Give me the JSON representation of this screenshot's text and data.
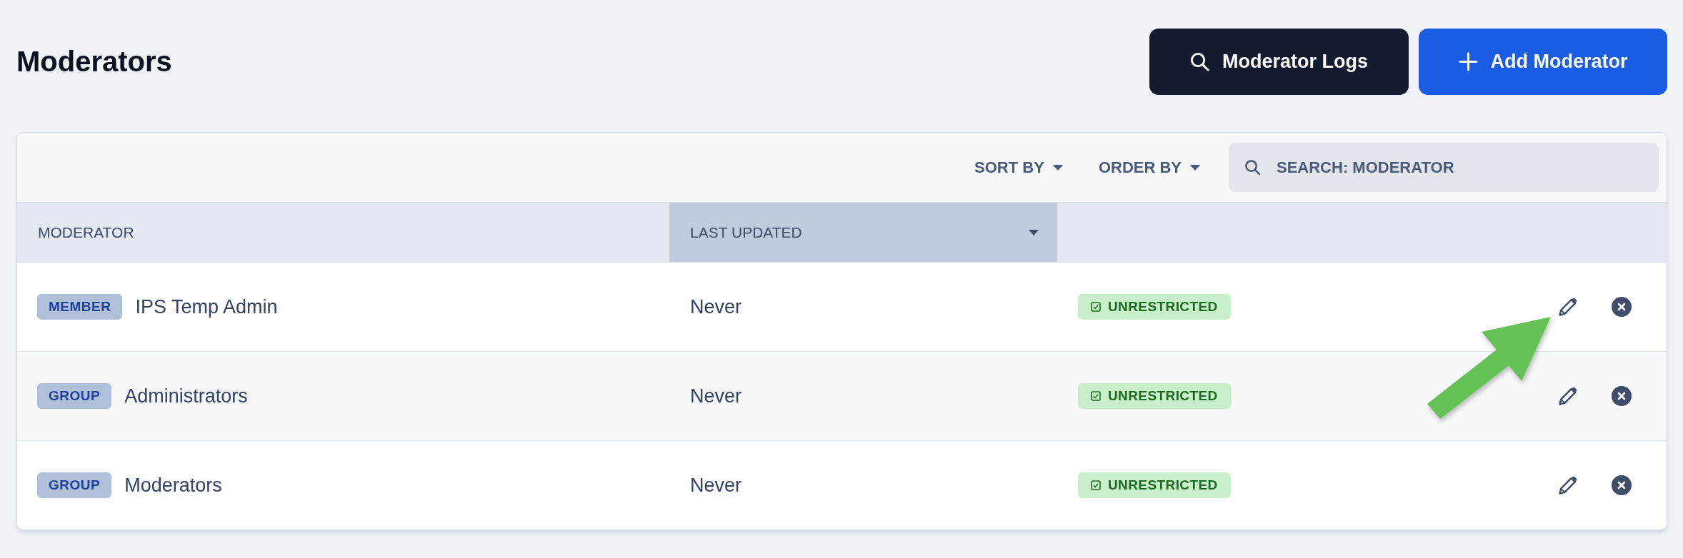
{
  "page": {
    "title": "Moderators"
  },
  "actions": [
    {
      "label": "Moderator Logs",
      "kind": "secondary"
    },
    {
      "label": "Add Moderator",
      "kind": "primary"
    }
  ],
  "toolbar": {
    "dropdowns": [
      "SORT BY",
      "ORDER BY"
    ],
    "search": {
      "placeholder": "SEARCH: MODERATOR"
    }
  },
  "table": {
    "columns": [
      {
        "label": "MODERATOR",
        "sorted": false
      },
      {
        "label": "LAST UPDATED",
        "sorted": true
      }
    ],
    "rows": [
      {
        "type": "MEMBER",
        "name": "IPS Temp Admin",
        "last_updated": "Never",
        "status": "UNRESTRICTED"
      },
      {
        "type": "GROUP",
        "name": "Administrators",
        "last_updated": "Never",
        "status": "UNRESTRICTED"
      },
      {
        "type": "GROUP",
        "name": "Moderators",
        "last_updated": "Never",
        "status": "UNRESTRICTED"
      }
    ]
  }
}
